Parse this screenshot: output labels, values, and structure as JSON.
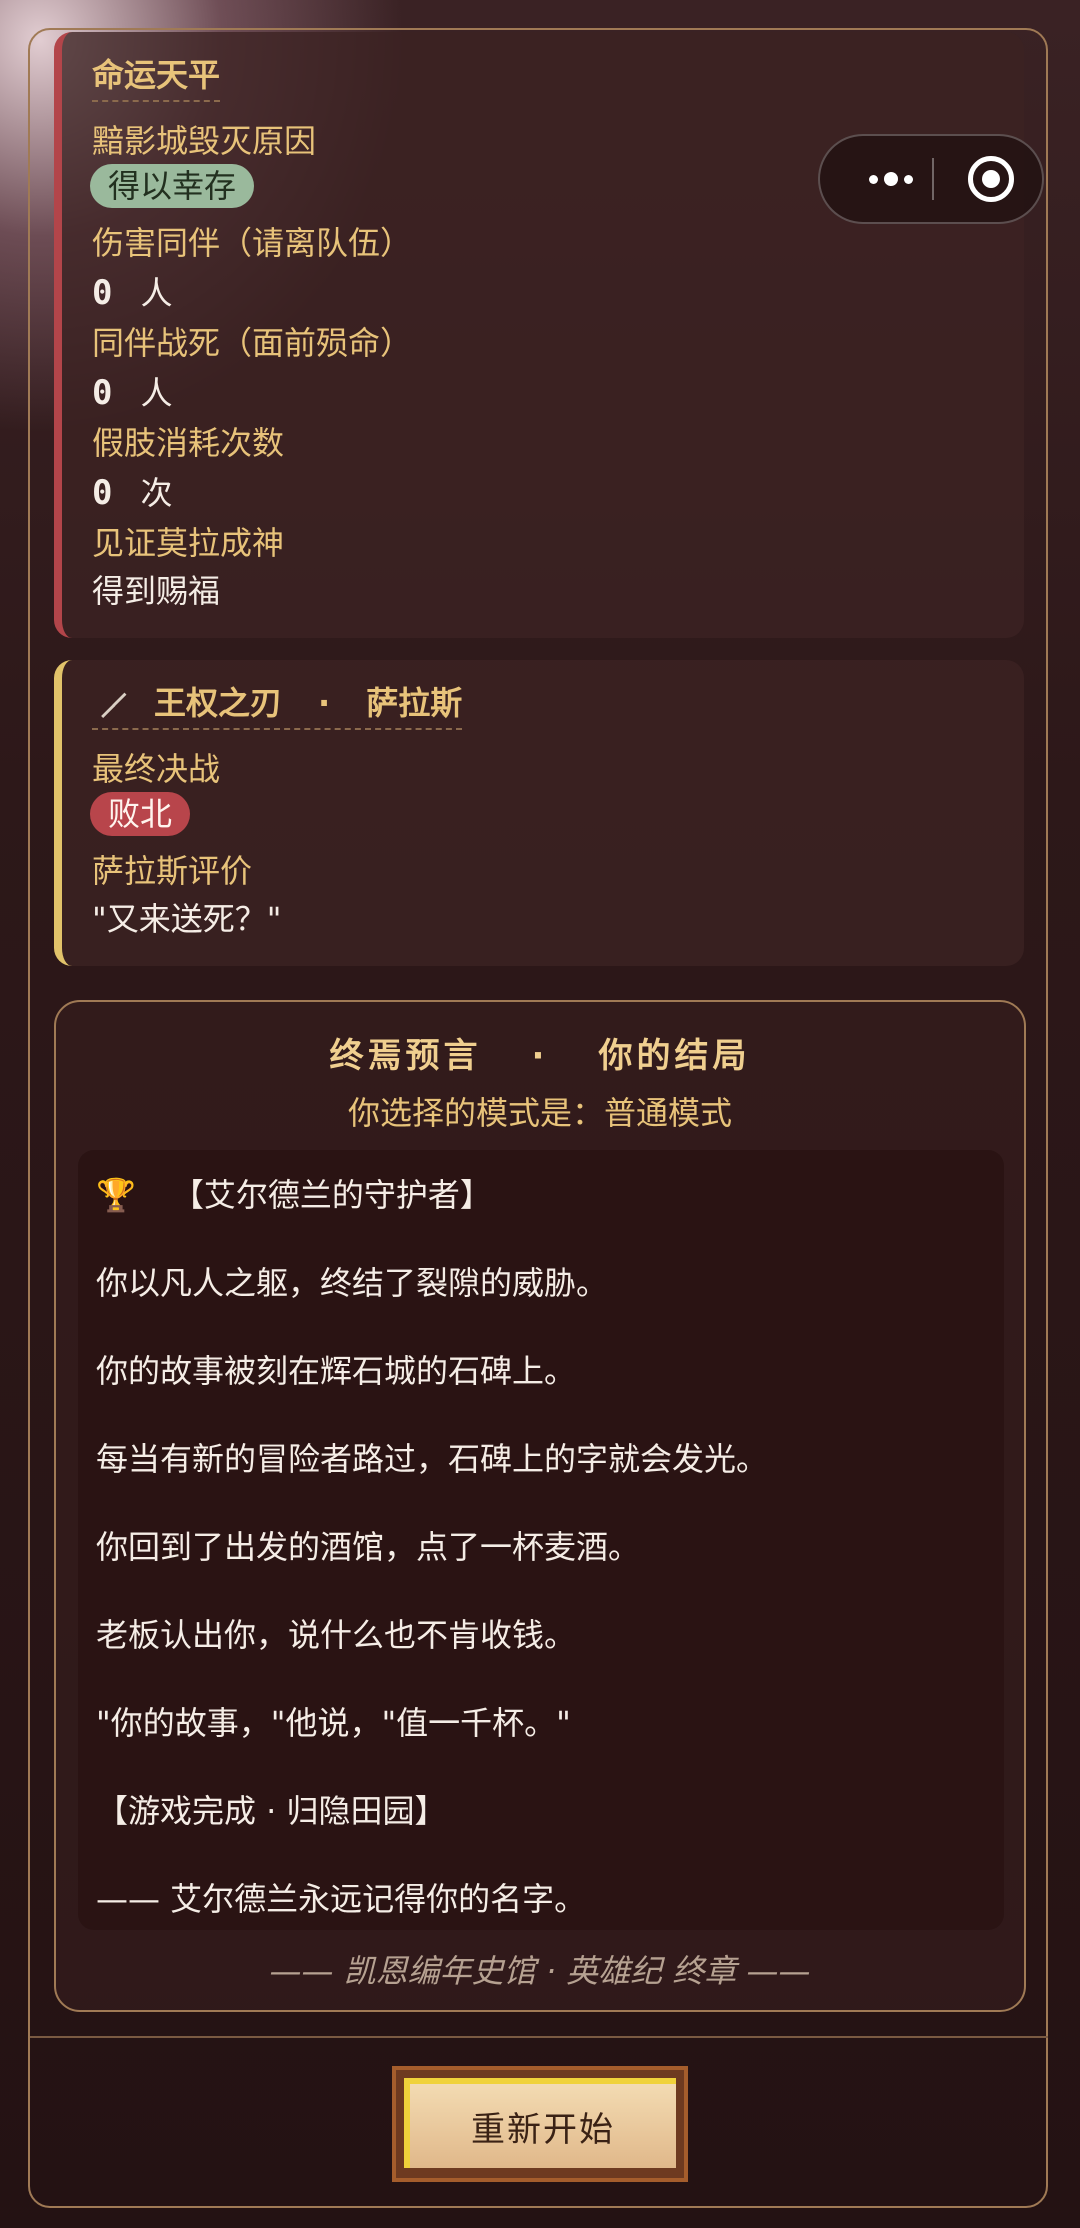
{
  "fate": {
    "title": "命运天平",
    "items": [
      {
        "label": "黯影城毁灭原因",
        "badge": "得以幸存"
      },
      {
        "label": "伤害同伴（请离队伍）",
        "count": "0",
        "unit": "人"
      },
      {
        "label": "同伴战死（面前殒命）",
        "count": "0",
        "unit": "人"
      },
      {
        "label": "假肢消耗次数",
        "count": "0",
        "unit": "次"
      },
      {
        "label": "见证莫拉成神",
        "value": "得到赐福"
      }
    ]
  },
  "boss": {
    "weapon": "王权之刃",
    "separator": "·",
    "name": "萨拉斯",
    "battle_label": "最终决战",
    "battle_result": "败北",
    "eval_label": "萨拉斯评价",
    "eval_quote": "\"又来送死？\""
  },
  "ending": {
    "title_left": "终焉预言",
    "title_sep": "·",
    "title_right": "你的结局",
    "mode_line": "你选择的模式是：普通模式",
    "lines": [
      "【艾尔德兰的守护者】",
      "你以凡人之躯，终结了裂隙的威胁。",
      "你的故事被刻在辉石城的石碑上。",
      "每当有新的冒险者路过，石碑上的字就会发光。",
      "你回到了出发的酒馆，点了一杯麦酒。",
      "老板认出你，说什么也不肯收钱。",
      "\"你的故事，\"他说，\"值一千杯。\"",
      "【游戏完成 · 归隐田园】",
      "—— 艾尔德兰永远记得你的名字。"
    ],
    "footer": "—— 凯恩编年史馆 · 英雄纪 终章 ——"
  },
  "restart_button": "重新开始",
  "colors": {
    "accent_gold": "#e8c37a",
    "danger": "#b8454b",
    "survive": "#9ab99c"
  }
}
